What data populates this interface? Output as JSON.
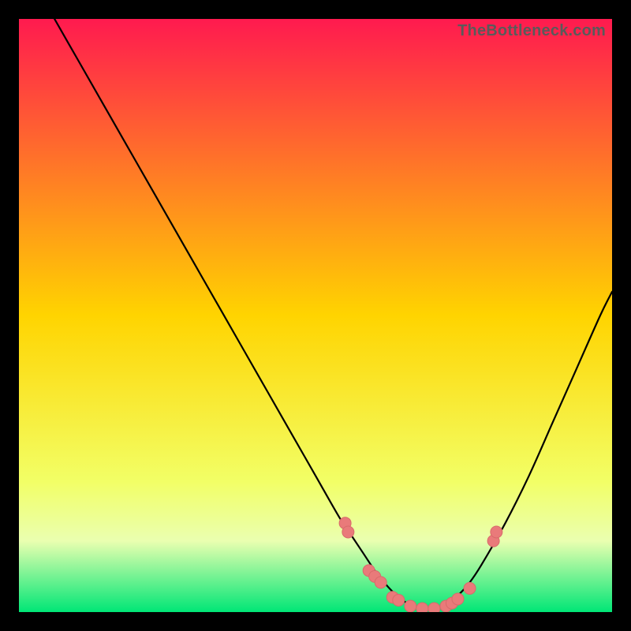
{
  "attribution": "TheBottleneck.com",
  "colors": {
    "gradient_top": "#ff1a4f",
    "gradient_mid": "#ffd400",
    "gradient_low": "#f2ff66",
    "gradient_band_light": "#eaffb0",
    "gradient_bottom": "#00e676",
    "curve": "#000000",
    "marker_fill": "#e97a7a",
    "marker_stroke": "#d86a6a",
    "frame_bg": "#000000"
  },
  "chart_data": {
    "type": "line",
    "title": "",
    "xlabel": "",
    "ylabel": "",
    "xlim": [
      0,
      100
    ],
    "ylim": [
      0,
      100
    ],
    "series": [
      {
        "name": "bottleneck-curve",
        "x": [
          6,
          10,
          14,
          18,
          22,
          26,
          30,
          34,
          38,
          42,
          46,
          50,
          54,
          56,
          58,
          60,
          62,
          64,
          66,
          68,
          70,
          72,
          74,
          76,
          78,
          82,
          86,
          90,
          94,
          98,
          100
        ],
        "y": [
          100,
          93,
          86,
          79,
          72,
          65,
          58,
          51,
          44,
          37,
          30,
          23,
          16,
          13,
          10,
          7,
          4.5,
          2.5,
          1.2,
          0.5,
          0.5,
          1.2,
          2.8,
          5,
          8,
          15,
          23,
          32,
          41,
          50,
          54
        ]
      }
    ],
    "markers": {
      "name": "highlighted-points",
      "x": [
        55,
        55.5,
        59,
        60,
        61,
        63,
        64,
        66,
        68,
        70,
        72,
        73,
        74,
        76,
        80,
        80.5
      ],
      "y": [
        15,
        13.5,
        7,
        6,
        5,
        2.5,
        2,
        1,
        0.6,
        0.6,
        1,
        1.5,
        2.2,
        4,
        12,
        13.5
      ]
    }
  }
}
